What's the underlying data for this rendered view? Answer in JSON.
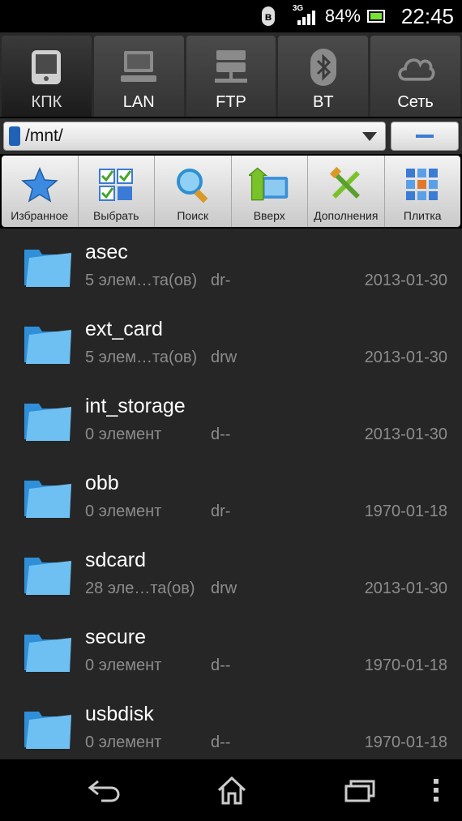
{
  "status": {
    "battery": "84%",
    "time": "22:45",
    "network": "3G"
  },
  "tabs": [
    {
      "label": "КПК",
      "icon": "device-icon",
      "active": true
    },
    {
      "label": "LAN",
      "icon": "computer-icon",
      "active": false
    },
    {
      "label": "FTP",
      "icon": "network-server-icon",
      "active": false
    },
    {
      "label": "BT",
      "icon": "bluetooth-icon",
      "active": false
    },
    {
      "label": "Сеть",
      "icon": "cloud-icon",
      "active": false
    }
  ],
  "path": {
    "value": "/mnt/"
  },
  "toolbar": [
    {
      "label": "Избранное",
      "icon": "star-icon"
    },
    {
      "label": "Выбрать",
      "icon": "checklist-icon"
    },
    {
      "label": "Поиск",
      "icon": "magnifier-icon"
    },
    {
      "label": "Вверх",
      "icon": "folder-up-icon"
    },
    {
      "label": "Дополнения",
      "icon": "tools-icon"
    },
    {
      "label": "Плитка",
      "icon": "grid-icon"
    }
  ],
  "files": [
    {
      "name": "asec",
      "count": "5 элем…та(ов)",
      "perm": "dr-",
      "date": "2013-01-30"
    },
    {
      "name": "ext_card",
      "count": "5 элем…та(ов)",
      "perm": "drw",
      "date": "2013-01-30"
    },
    {
      "name": "int_storage",
      "count": "0 элемент",
      "perm": "d--",
      "date": "2013-01-30"
    },
    {
      "name": "obb",
      "count": "0 элемент",
      "perm": "dr-",
      "date": "1970-01-18"
    },
    {
      "name": "sdcard",
      "count": "28 эле…та(ов)",
      "perm": "drw",
      "date": "2013-01-30"
    },
    {
      "name": "secure",
      "count": "0 элемент",
      "perm": "d--",
      "date": "1970-01-18"
    },
    {
      "name": "usbdisk",
      "count": "0 элемент",
      "perm": "d--",
      "date": "1970-01-18"
    }
  ],
  "colors": {
    "accent_blue": "#3a7bd5",
    "battery_green": "#7be036",
    "list_bg": "#262626"
  }
}
